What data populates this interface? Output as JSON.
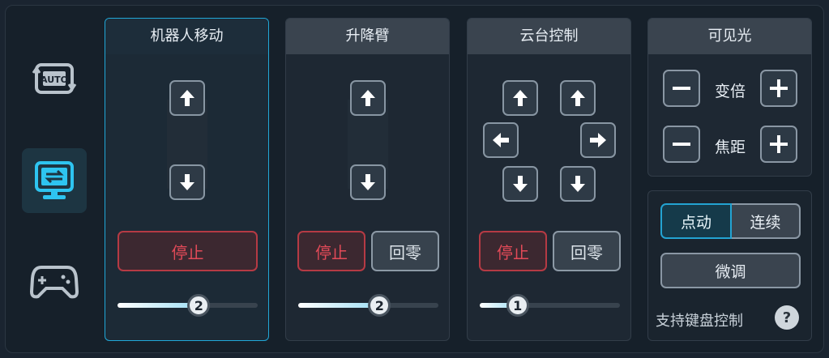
{
  "sidebar": {
    "items": [
      {
        "icon": "auto-mode-icon",
        "label": "AUTO",
        "active": false
      },
      {
        "icon": "monitor-switch-icon",
        "active": true
      },
      {
        "icon": "gamepad-icon",
        "active": false
      }
    ]
  },
  "panels": {
    "robot_move": {
      "title": "机器人移动",
      "stop_label": "停止",
      "speed_value": "2",
      "speed_level": 0.58
    },
    "lift_arm": {
      "title": "升降臂",
      "stop_label": "停止",
      "zero_label": "回零",
      "speed_value": "2",
      "speed_level": 0.58
    },
    "gimbal": {
      "title": "云台控制",
      "stop_label": "停止",
      "zero_label": "回零",
      "speed_value": "1",
      "speed_level": 0.27
    },
    "visible_light": {
      "title": "可见光",
      "zoom_label": "变倍",
      "focus_label": "焦距"
    },
    "mode": {
      "jog_label": "点动",
      "continuous_label": "连续",
      "fine_label": "微调",
      "keyboard_text": "支持键盘控制",
      "help_symbol": "?"
    }
  },
  "colors": {
    "accent": "#21a8d8",
    "stop_red": "#b53a44",
    "panel_bg": "#1e2833"
  }
}
